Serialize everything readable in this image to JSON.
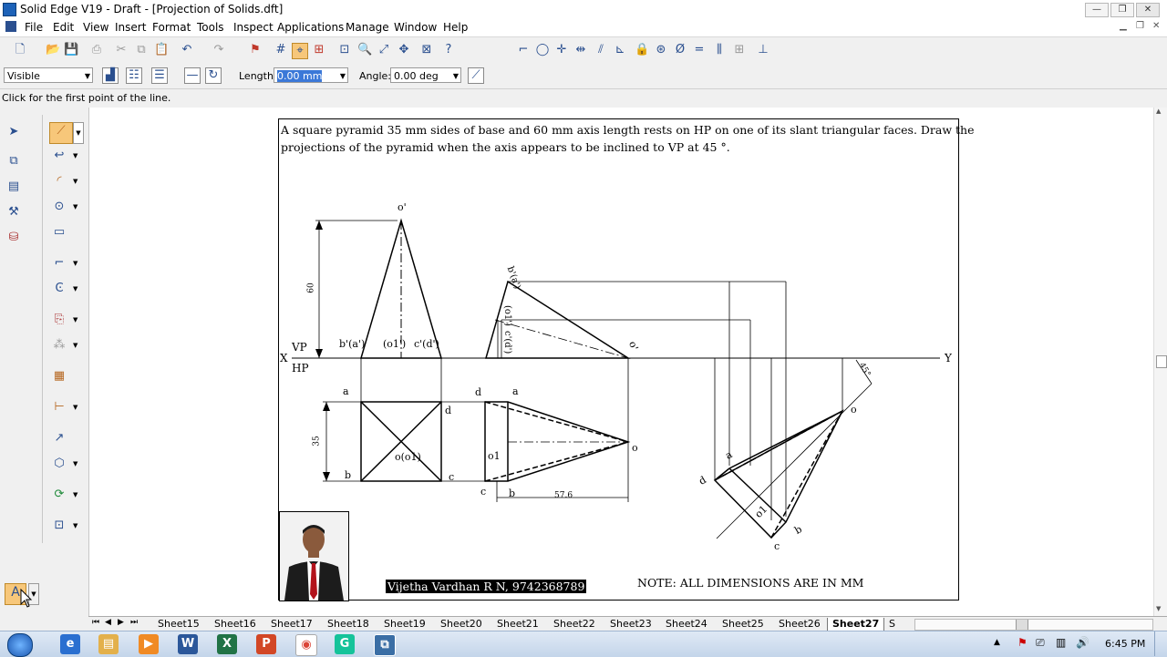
{
  "window": {
    "title": "Solid Edge V19 - Draft - [Projection of Solids.dft]"
  },
  "menu": [
    "File",
    "Edit",
    "View",
    "Insert",
    "Format",
    "Tools",
    "Inspect",
    "Applications",
    "Manage",
    "Window",
    "Help"
  ],
  "ribbon": {
    "line_style": "Visible",
    "length_label": "Length:",
    "length_value": "0.00 mm",
    "angle_label": "Angle:",
    "angle_value": "0.00 deg"
  },
  "prompt": "Click for the first point of the line.",
  "drawing": {
    "problem": [
      "A square pyramid 35 mm sides of base and 60 mm axis length rests on HP on one of its slant triangular faces. Draw the",
      "projections of the pyramid when the axis appears to be inclined to VP at 45 °."
    ],
    "labels": {
      "o_prime": "o'",
      "dim_60": "60",
      "vp": "VP",
      "hp": "HP",
      "x": "X",
      "y": "Y",
      "b_a_prime": "b'(a')",
      "o1_prime": "(o1')",
      "c_d_prime": "c'(d')",
      "a": "a",
      "b": "b",
      "c": "c",
      "d": "d",
      "dim_35": "35",
      "o_o1": "o(o1)",
      "b_a_prime_2": "b'(a')",
      "o1_prime_2": "(o1')",
      "c_d_prime_2": "c'(d')",
      "o_prime_2": "o'",
      "d2": "d",
      "a2": "a",
      "o1_2": "o1",
      "o2": "o",
      "c2": "c",
      "b2": "b",
      "dim_576": "57.6",
      "angle_45": "45°",
      "o3": "o",
      "a3": "a",
      "d3": "d",
      "o1_3": "o1",
      "c3": "c",
      "b3": "b"
    },
    "author": "Vijetha Vardhan R N, 9742368789",
    "note": "NOTE: ALL DIMENSIONS ARE IN MM"
  },
  "sheets": [
    "Sheet15",
    "Sheet16",
    "Sheet17",
    "Sheet18",
    "Sheet19",
    "Sheet20",
    "Sheet21",
    "Sheet22",
    "Sheet23",
    "Sheet24",
    "Sheet25",
    "Sheet26",
    "Sheet27",
    "S"
  ],
  "active_sheet": "Sheet27",
  "taskbar": {
    "time": "6:45 PM"
  }
}
